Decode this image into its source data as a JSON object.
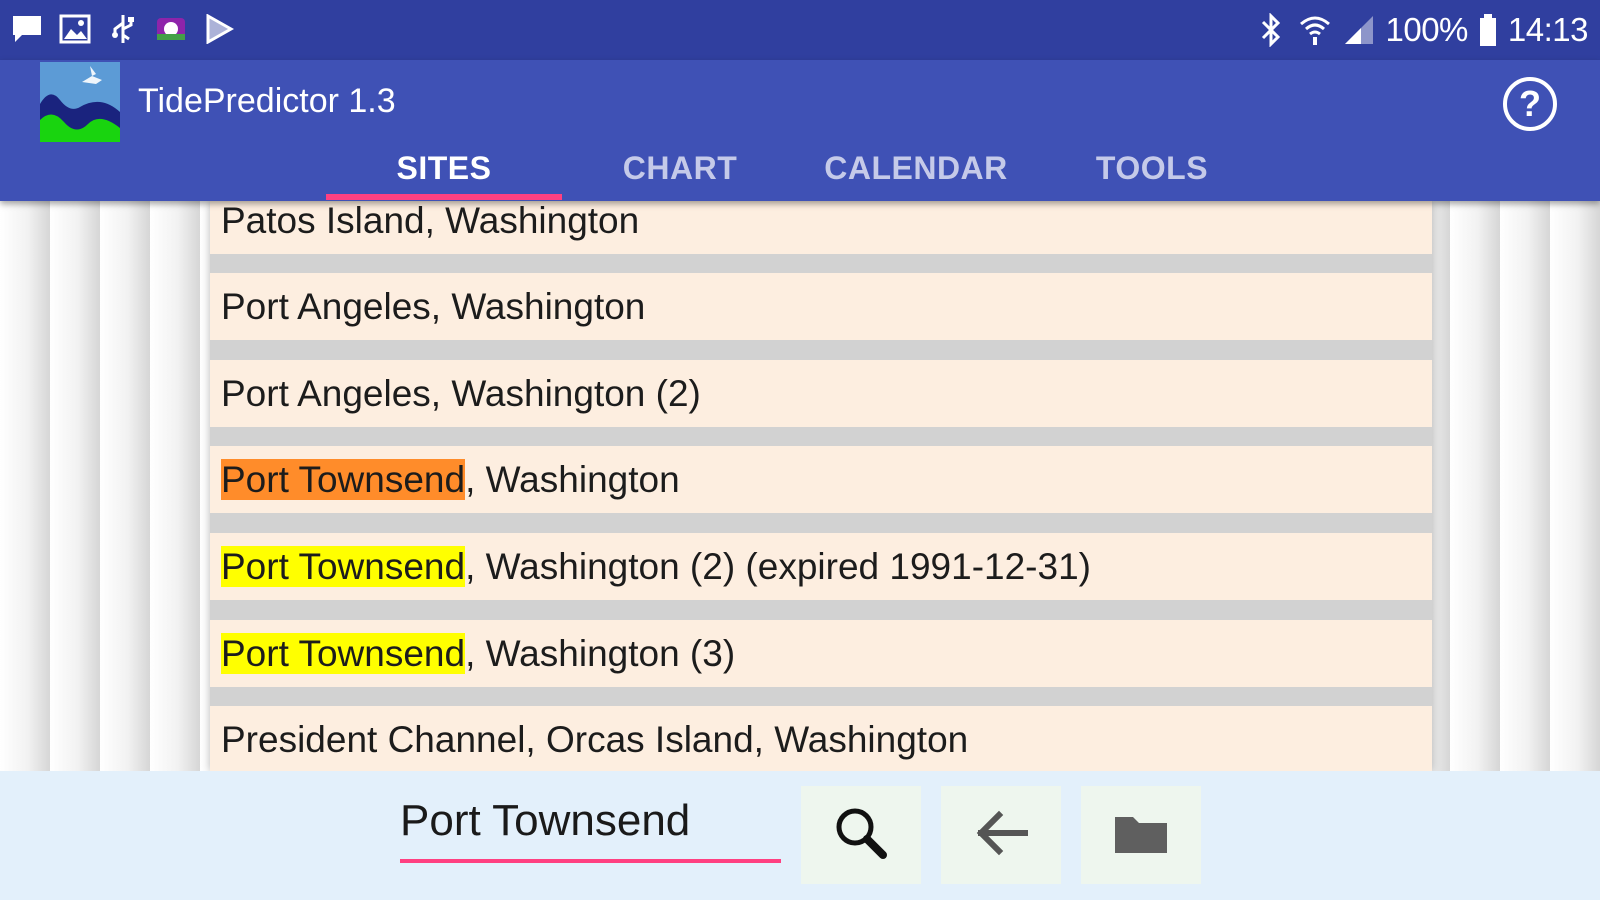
{
  "status_bar": {
    "battery": "100%",
    "time": "14:13"
  },
  "app_bar": {
    "title": "TidePredictor 1.3",
    "help_label": "?"
  },
  "tabs": [
    {
      "label": "SITES",
      "active": true
    },
    {
      "label": "CHART",
      "active": false
    },
    {
      "label": "CALENDAR",
      "active": false
    },
    {
      "label": "TOOLS",
      "active": false
    }
  ],
  "site_list": {
    "items": [
      {
        "highlight": "",
        "highlight_type": "none",
        "rest": "Patos Island, Washington"
      },
      {
        "highlight": "",
        "highlight_type": "none",
        "rest": "Port Angeles, Washington"
      },
      {
        "highlight": "",
        "highlight_type": "none",
        "rest": "Port Angeles, Washington (2)"
      },
      {
        "highlight": "Port Townsend",
        "highlight_type": "selected",
        "rest": ", Washington"
      },
      {
        "highlight": "Port Townsend",
        "highlight_type": "match",
        "rest": ", Washington (2) (expired 1991-12-31)"
      },
      {
        "highlight": "Port Townsend",
        "highlight_type": "match",
        "rest": ", Washington (3)"
      },
      {
        "highlight": "",
        "highlight_type": "none",
        "rest": "President Channel, Orcas Island, Washington"
      }
    ]
  },
  "bottom_bar": {
    "search_value": "Port Townsend"
  },
  "colors": {
    "status_bar": "#303f9f",
    "app_bar": "#3f51b5",
    "accent": "#ff4081",
    "list_item_bg": "#fdeee0",
    "selected_highlight": "#ff8c2a",
    "match_highlight": "#ffff00",
    "bottom_bar": "#e3f0fb"
  },
  "icons": {
    "search_button": "search-icon",
    "back_button": "arrow-left-icon",
    "folder_button": "folder-icon"
  }
}
